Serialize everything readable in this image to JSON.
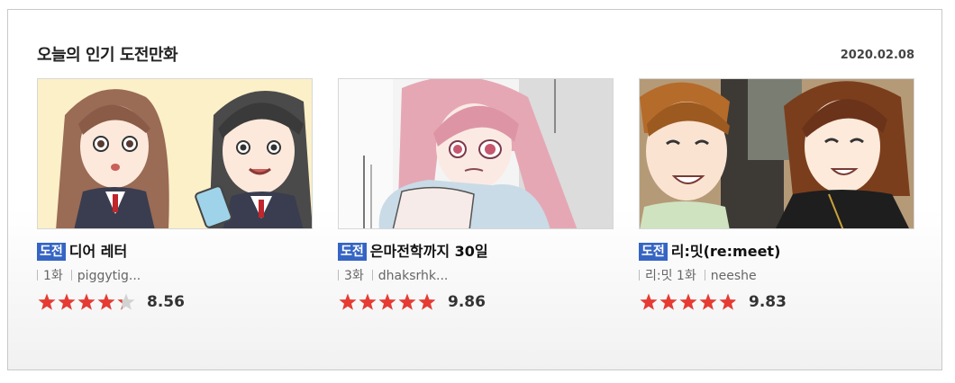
{
  "section": {
    "title": "오늘의 인기 도전만화",
    "date": "2020.02.08"
  },
  "colors": {
    "badge": "#3565c4",
    "star_on": "#e63b33",
    "star_off": "#d2d2d2"
  },
  "cards": [
    {
      "badge": "도전",
      "title": "디어 레터",
      "episode": "1화",
      "author": "piggytig...",
      "rating": 4.28,
      "score": "8.56",
      "thumbnail_icon": "comic-thumbnail-two-schoolgirls"
    },
    {
      "badge": "도전",
      "title": "은마전학까지 30일",
      "episode": "3화",
      "author": "dhaksrhk...",
      "rating": 4.93,
      "score": "9.86",
      "thumbnail_icon": "comic-thumbnail-pink-haired-girl"
    },
    {
      "badge": "도전",
      "title": "리:밋(re:meet)",
      "episode": "리:밋 1화",
      "author": "neeshe",
      "rating": 4.915,
      "score": "9.83",
      "thumbnail_icon": "comic-thumbnail-smiling-friends"
    }
  ]
}
